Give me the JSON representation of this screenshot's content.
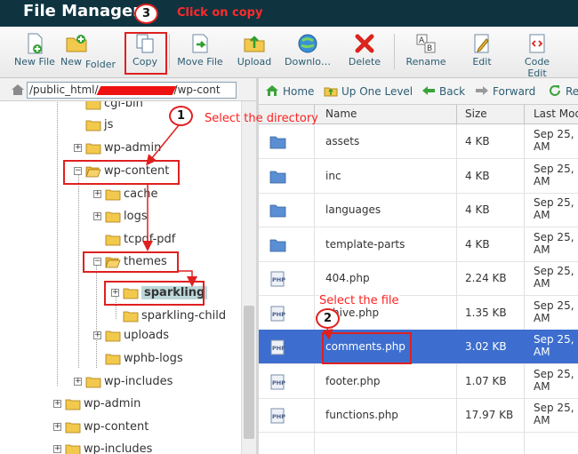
{
  "app": {
    "title": "File Manager"
  },
  "toolbar": {
    "buttons": [
      {
        "label": "New File",
        "icon": "new-file-icon"
      },
      {
        "label": "New",
        "label2": "Folder",
        "icon": "new-folder-icon"
      },
      {
        "label": "Copy",
        "icon": "copy-icon"
      },
      {
        "label": "Move File",
        "icon": "move-file-icon"
      },
      {
        "label": "Upload",
        "icon": "upload-icon"
      },
      {
        "label": "Downlo…",
        "icon": "download-icon"
      },
      {
        "label": "Delete",
        "icon": "delete-icon"
      },
      {
        "label": "Rename",
        "icon": "rename-icon"
      },
      {
        "label": "Edit",
        "icon": "edit-icon"
      },
      {
        "label": "Code",
        "label2": "Edit",
        "icon": "code-edit-icon"
      }
    ]
  },
  "path": {
    "prefix": "/public_html/",
    "suffix": "/wp-cont"
  },
  "nav": {
    "home": "Home",
    "up": "Up One Level",
    "back": "Back",
    "forward": "Forward",
    "reload": "Re"
  },
  "tree": {
    "items": [
      {
        "label": "cgi-bin",
        "expander": ""
      },
      {
        "label": "js",
        "expander": ""
      },
      {
        "label": "wp-admin",
        "expander": "+"
      },
      {
        "label": "wp-content",
        "expander": "−"
      },
      {
        "label": "cache",
        "expander": "+"
      },
      {
        "label": "logs",
        "expander": "+"
      },
      {
        "label": "tcpdf-pdf",
        "expander": ""
      },
      {
        "label": "themes",
        "expander": "−"
      },
      {
        "label": "sparkling",
        "expander": "+"
      },
      {
        "label": "sparkling-child",
        "expander": ""
      },
      {
        "label": "uploads",
        "expander": "+"
      },
      {
        "label": "wphb-logs",
        "expander": ""
      },
      {
        "label": "wp-includes",
        "expander": "+"
      },
      {
        "label": "wp-admin",
        "expander": "+"
      },
      {
        "label": "wp-content",
        "expander": "+"
      },
      {
        "label": "wp-includes",
        "expander": "+"
      }
    ]
  },
  "files": {
    "columns": {
      "name": "Name",
      "size": "Size",
      "modified": "Last Mod"
    },
    "rows": [
      {
        "name": "assets",
        "size": "4 KB",
        "date1": "Sep 25,",
        "date2": "AM",
        "type": "folder"
      },
      {
        "name": "inc",
        "size": "4 KB",
        "date1": "Sep 25,",
        "date2": "AM",
        "type": "folder"
      },
      {
        "name": "languages",
        "size": "4 KB",
        "date1": "Sep 25,",
        "date2": "AM",
        "type": "folder"
      },
      {
        "name": "template-parts",
        "size": "4 KB",
        "date1": "Sep 25,",
        "date2": "AM",
        "type": "folder"
      },
      {
        "name": "404.php",
        "size": "2.24 KB",
        "date1": "Sep 25,",
        "date2": "AM",
        "type": "php"
      },
      {
        "name": "hive.php",
        "size": "1.35 KB",
        "date1": "Sep 25,",
        "date2": "AM",
        "type": "php"
      },
      {
        "name": "comments.php",
        "size": "3.02 KB",
        "date1": "Sep 25,",
        "date2": "AM",
        "type": "php"
      },
      {
        "name": "footer.php",
        "size": "1.07 KB",
        "date1": "Sep 25,",
        "date2": "AM",
        "type": "php"
      },
      {
        "name": "functions.php",
        "size": "17.97 KB",
        "date1": "Sep 25,",
        "date2": "AM",
        "type": "php"
      }
    ]
  },
  "annotations": {
    "step1": "1",
    "step1_text": "Select the directory",
    "step2": "2",
    "step2_text": "Select the file",
    "step3": "3",
    "step3_text": "Click on copy"
  },
  "colors": {
    "title_bar": "#0f3440",
    "selection": "#3d6ecf",
    "annotation": "#e02020",
    "link": "#2b5d73"
  }
}
